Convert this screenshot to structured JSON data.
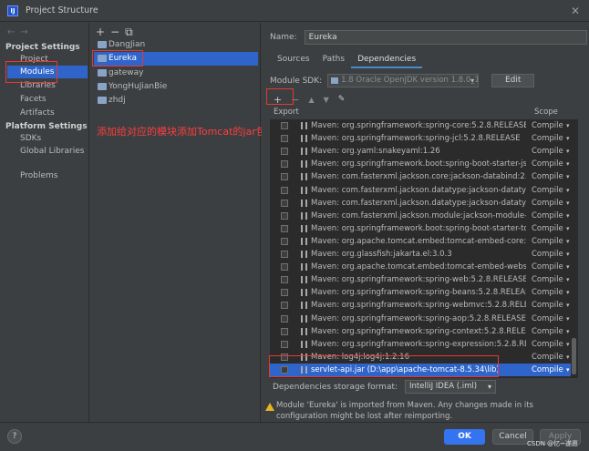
{
  "window": {
    "title": "Project Structure"
  },
  "left_nav": {
    "project_settings_header": "Project Settings",
    "project_settings": [
      "Project",
      "Modules",
      "Libraries",
      "Facets",
      "Artifacts"
    ],
    "platform_settings_header": "Platform Settings",
    "platform_settings": [
      "SDKs",
      "Global Libraries"
    ],
    "problems": "Problems",
    "selected": "Modules"
  },
  "modules": {
    "toolbar": [
      "+",
      "−",
      "⧉"
    ],
    "items": [
      "DangJian",
      "Eureka",
      "gateway",
      "YongHuJianBie",
      "zhdj"
    ],
    "selected": "Eureka"
  },
  "annotation_text": "添加给对应的模块添加Tomcat的jar包",
  "detail": {
    "name_label": "Name:",
    "name_value": "Eureka",
    "tabs": [
      "Sources",
      "Paths",
      "Dependencies"
    ],
    "active_tab": "Dependencies",
    "sdk_label": "Module SDK:",
    "sdk_value": "1.8 Oracle OpenJDK version 1.8.0_192",
    "edit_label": "Edit",
    "dep_toolbar": [
      "+",
      "−",
      "▲",
      "▼",
      "✎"
    ],
    "export_header": "Export",
    "scope_header": "Scope",
    "dependencies": [
      {
        "name": "Maven: org.springframework:spring-core:5.2.8.RELEASE",
        "scope": "Compile"
      },
      {
        "name": "Maven: org.springframework:spring-jcl:5.2.8.RELEASE",
        "scope": "Compile"
      },
      {
        "name": "Maven: org.yaml:snakeyaml:1.26",
        "scope": "Compile"
      },
      {
        "name": "Maven: org.springframework.boot:spring-boot-starter-json:2.3",
        "scope": "Compile"
      },
      {
        "name": "Maven: com.fasterxml.jackson.core:jackson-databind:2.11.1",
        "scope": "Compile"
      },
      {
        "name": "Maven: com.fasterxml.jackson.datatype:jackson-datatype-jdk8",
        "scope": "Compile"
      },
      {
        "name": "Maven: com.fasterxml.jackson.datatype:jackson-datatype-jsr31",
        "scope": "Compile"
      },
      {
        "name": "Maven: com.fasterxml.jackson.module:jackson-module-param",
        "scope": "Compile"
      },
      {
        "name": "Maven: org.springframework.boot:spring-boot-starter-tomcat:",
        "scope": "Compile"
      },
      {
        "name": "Maven: org.apache.tomcat.embed:tomcat-embed-core:9.0.37",
        "scope": "Compile"
      },
      {
        "name": "Maven: org.glassfish:jakarta.el:3.0.3",
        "scope": "Compile"
      },
      {
        "name": "Maven: org.apache.tomcat.embed:tomcat-embed-websocket:9",
        "scope": "Compile"
      },
      {
        "name": "Maven: org.springframework:spring-web:5.2.8.RELEASE",
        "scope": "Compile"
      },
      {
        "name": "Maven: org.springframework:spring-beans:5.2.8.RELEASE",
        "scope": "Compile"
      },
      {
        "name": "Maven: org.springframework:spring-webmvc:5.2.8.RELEASE",
        "scope": "Compile"
      },
      {
        "name": "Maven: org.springframework:spring-aop:5.2.8.RELEASE",
        "scope": "Compile"
      },
      {
        "name": "Maven: org.springframework:spring-context:5.2.8.RELEASE",
        "scope": "Compile"
      },
      {
        "name": "Maven: org.springframework:spring-expression:5.2.8.RELEASE",
        "scope": "Compile"
      },
      {
        "name": "Maven: log4j:log4j:1.2.16",
        "scope": "Compile"
      },
      {
        "name": "servlet-api.jar (D:\\app\\apache-tomcat-8.5.34\\lib)",
        "scope": "Compile"
      }
    ],
    "selected_dependency_index": 19,
    "storage_label": "Dependencies storage format:",
    "storage_value": "IntelliJ IDEA (.iml)",
    "warning": "Module 'Eureka' is imported from Maven. Any changes made in its configuration might be lost after reimporting."
  },
  "footer": {
    "help": "?",
    "ok": "OK",
    "cancel": "Cancel",
    "apply": "Apply",
    "watermark": "CSDN @忆~遂愿"
  },
  "colors": {
    "background": "#3c3f41",
    "selection": "#2f65ca",
    "primary_button": "#3574f0",
    "annotation_red": "#e53935",
    "warning": "#e6b422"
  }
}
